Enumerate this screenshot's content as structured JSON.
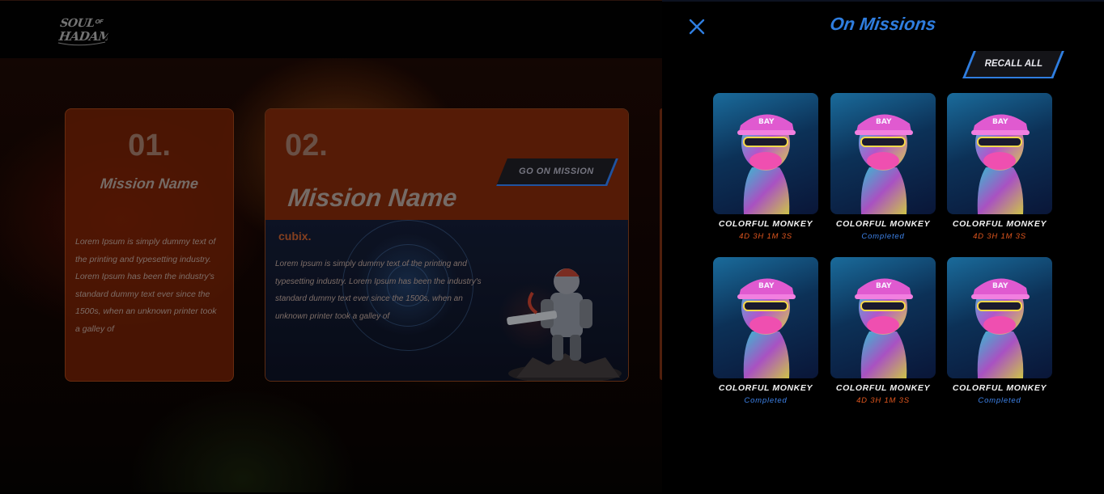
{
  "header": {
    "logo_text": "SOUL OF HADAM"
  },
  "missions": [
    {
      "number": "01.",
      "name": "Mission Name",
      "description": "Lorem Ipsum is simply dummy text of the printing and typesetting industry. Lorem Ipsum has been the industry's standard dummy text ever since the 1500s, when an unknown printer took a galley of"
    },
    {
      "number": "02.",
      "name": "Mission Name",
      "button_label": "GO ON MISSION",
      "brand": "cubix.",
      "description": "Lorem Ipsum is simply dummy text of the printing and typesetting industry. Lorem Ipsum has been the industry's standard dummy text ever since the 1500s, when an unknown printer took a galley of"
    }
  ],
  "panel": {
    "title": "On Missions",
    "recall_label": "RECALL ALL",
    "close_icon": "close-icon",
    "items": [
      {
        "name": "COLORFUL MONKEY",
        "status": "4D 3H 1M 3S",
        "status_type": "timer"
      },
      {
        "name": "COLORFUL MONKEY",
        "status": "Completed",
        "status_type": "completed"
      },
      {
        "name": "COLORFUL MONKEY",
        "status": "4D 3H 1M 3S",
        "status_type": "timer"
      },
      {
        "name": "COLORFUL MONKEY",
        "status": "Completed",
        "status_type": "completed"
      },
      {
        "name": "COLORFUL MONKEY",
        "status": "4D 3H 1M 3S",
        "status_type": "timer"
      },
      {
        "name": "COLORFUL MONKEY",
        "status": "Completed",
        "status_type": "completed"
      }
    ]
  },
  "colors": {
    "accent_blue": "#2f7ee0",
    "timer_orange": "#e0561e",
    "completed_blue": "#3d82e8",
    "card_orange": "#7d2605"
  }
}
